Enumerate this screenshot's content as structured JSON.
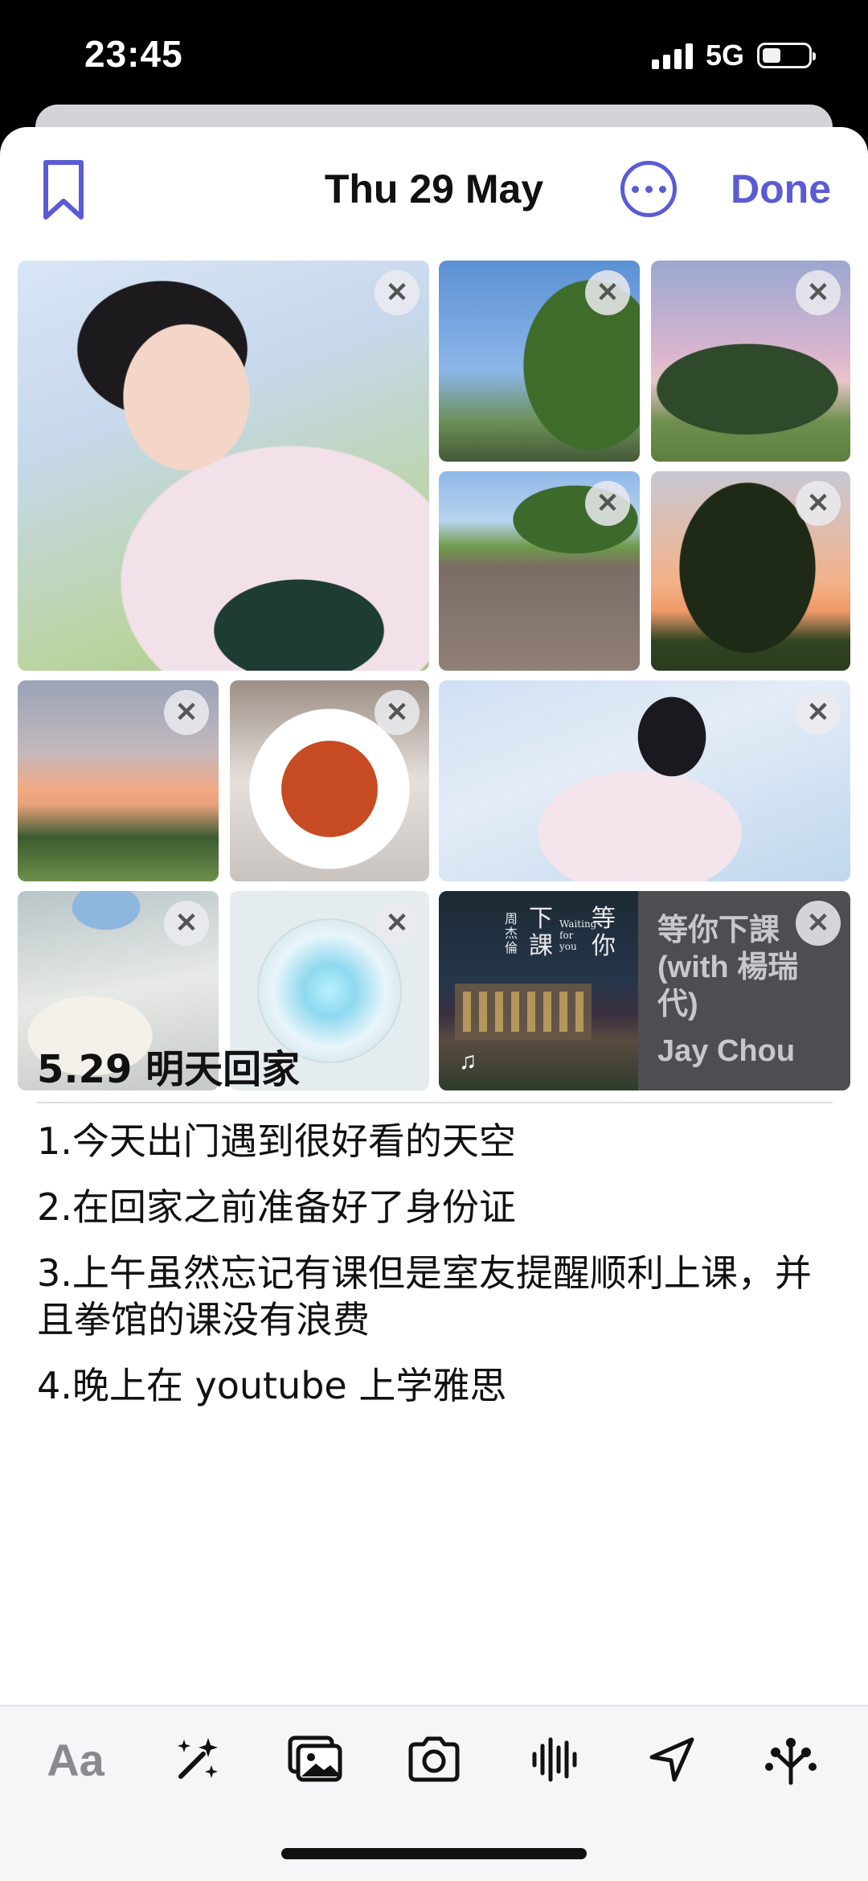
{
  "status": {
    "time": "23:45",
    "network": "5G",
    "battery_level": 0.4
  },
  "header": {
    "date": "Thu 29 May",
    "done_label": "Done"
  },
  "accent_color": "#5b5bd6",
  "music_card": {
    "song": "等你下課 (with 楊瑞代)",
    "artist": "Jay Chou",
    "album_title": "等你下課",
    "album_artist": "周杰倫",
    "album_subtitle": "Waiting for you"
  },
  "entry": {
    "title": "5.29 明天回家",
    "items": [
      "1.今天出门遇到很好看的天空",
      "2.在回家之前准备好了身份证",
      "3.上午虽然忘记有课但是室友提醒顺利上课，并且拳馆的课没有浪费",
      "4.晚上在 youtube 上学雅思"
    ]
  },
  "toolbar": {
    "text_style_label": "Aa"
  }
}
